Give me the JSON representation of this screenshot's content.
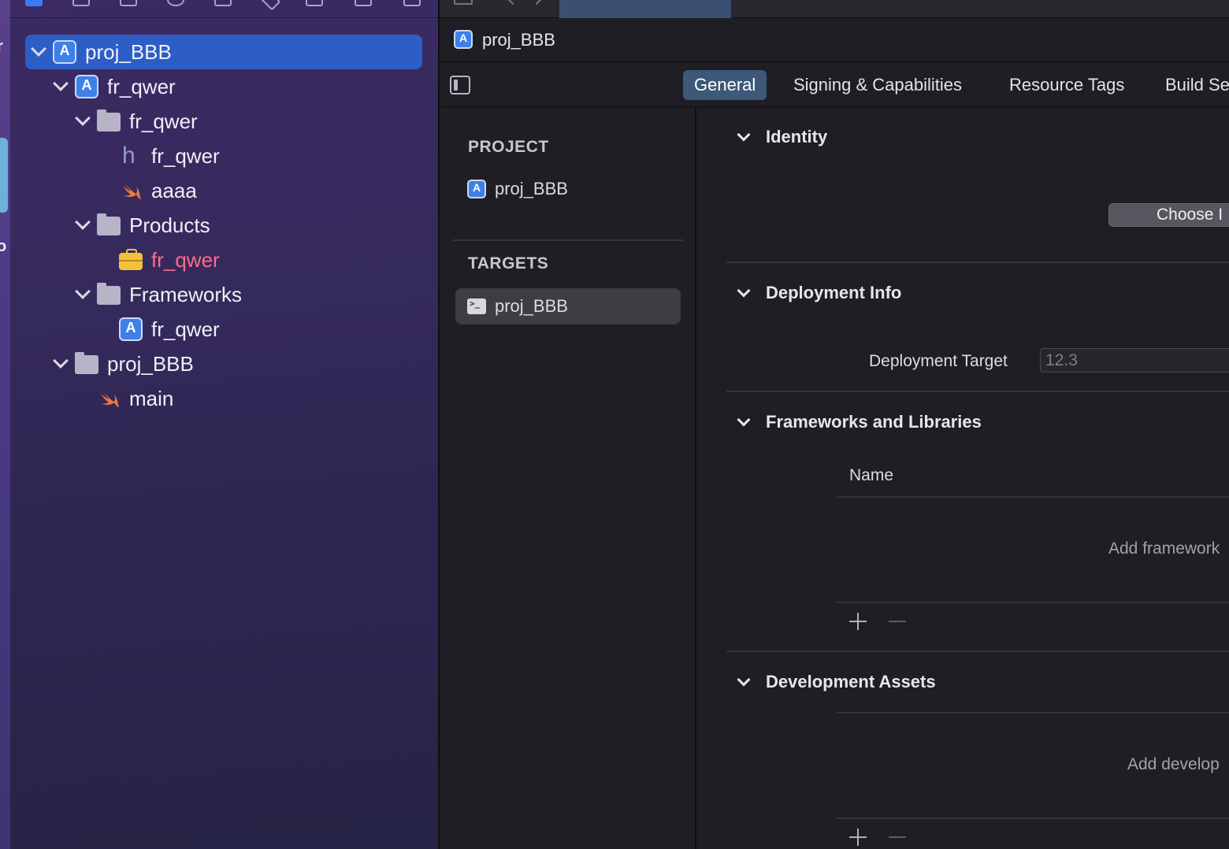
{
  "navigator": {
    "tree": [
      {
        "label": "proj_BBB",
        "icon": "xcode-project-icon",
        "selected": true
      },
      {
        "label": "fr_qwer",
        "icon": "xcode-project-icon"
      },
      {
        "label": "fr_qwer",
        "icon": "folder-icon"
      },
      {
        "label": "fr_qwer",
        "icon": "header-file-icon",
        "glyph": "h"
      },
      {
        "label": "aaaa",
        "icon": "swift-file-icon"
      },
      {
        "label": "Products",
        "icon": "folder-icon"
      },
      {
        "label": "fr_qwer",
        "icon": "framework-icon",
        "color": "#ff6b8a"
      },
      {
        "label": "Frameworks",
        "icon": "folder-icon"
      },
      {
        "label": "fr_qwer",
        "icon": "xcode-project-icon"
      },
      {
        "label": "proj_BBB",
        "icon": "folder-icon"
      },
      {
        "label": "main",
        "icon": "swift-file-icon"
      }
    ]
  },
  "jumpbar": {
    "title": "proj_BBB"
  },
  "settings_tabs": [
    "General",
    "Signing & Capabilities",
    "Resource Tags",
    "Build Se"
  ],
  "active_tab": "General",
  "target_list": {
    "project_header": "PROJECT",
    "project_item": "proj_BBB",
    "targets_header": "TARGETS",
    "target_item": "proj_BBB"
  },
  "content": {
    "identity": {
      "title": "Identity",
      "choose_button": "Choose I"
    },
    "deployment": {
      "title": "Deployment Info",
      "target_label": "Deployment Target",
      "target_placeholder": "12.3"
    },
    "frameworks": {
      "title": "Frameworks and Libraries",
      "column_name": "Name",
      "empty_text": "Add framework"
    },
    "dev_assets": {
      "title": "Development Assets",
      "empty_text": "Add develop"
    }
  },
  "colors": {
    "accent": "#2c5ec6",
    "product_red": "#ff6b8a",
    "tab_active": "#3d5878"
  },
  "desk_strip": {
    "text_r": "r",
    "text_o": "o"
  }
}
